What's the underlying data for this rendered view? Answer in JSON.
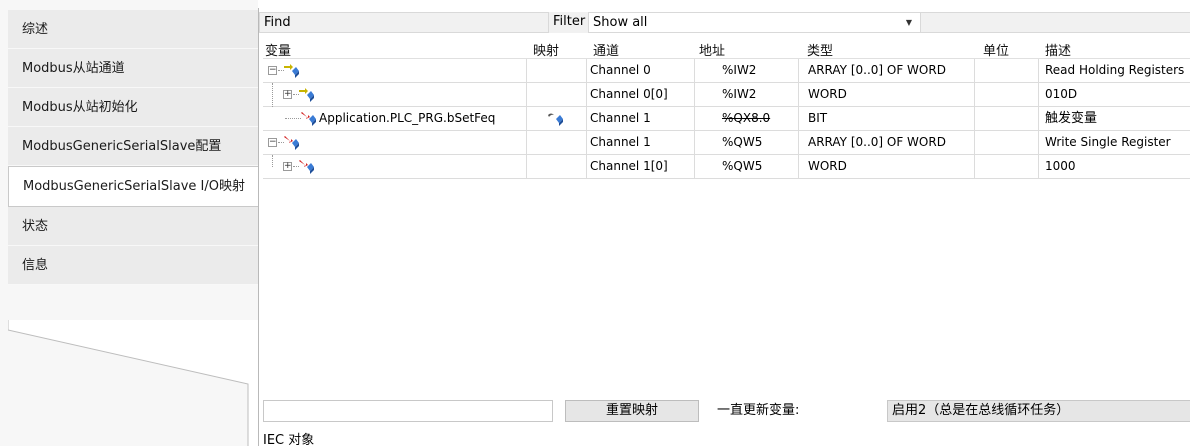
{
  "nav": {
    "items": [
      {
        "label": "综述"
      },
      {
        "label": "Modbus从站通道"
      },
      {
        "label": "Modbus从站初始化"
      },
      {
        "label": "ModbusGenericSerialSlave配置"
      },
      {
        "label": "ModbusGenericSerialSlave I/O映射",
        "active": true
      },
      {
        "label": "状态"
      },
      {
        "label": "信息"
      }
    ]
  },
  "toolbar": {
    "find_label": "Find",
    "filter_label": "Filter",
    "filter_value": "Show all"
  },
  "table": {
    "columns": [
      "变量",
      "映射",
      "通道",
      "地址",
      "类型",
      "单位",
      "描述"
    ],
    "rows": [
      {
        "variable": "",
        "mapping": "",
        "channel": "Channel 0",
        "address": "%IW2",
        "type": "ARRAY [0..0] OF WORD",
        "unit": "",
        "description": "Read Holding Registers",
        "expander": "−",
        "icon": "input-channel-icon"
      },
      {
        "variable": "",
        "mapping": "",
        "channel": "Channel 0[0]",
        "address": "%IW2",
        "type": "WORD",
        "unit": "",
        "description": "010D",
        "expander": "+",
        "icon": "input-channel-icon"
      },
      {
        "variable": "Application.PLC_PRG.bSetFeq",
        "mapping": "mapped",
        "channel": "Channel 1",
        "address": "%QX8.0",
        "type": "BIT",
        "unit": "",
        "description": "触发变量",
        "expander": "",
        "icon": "output-channel-icon"
      },
      {
        "variable": "",
        "mapping": "",
        "channel": "Channel 1",
        "address": "%QW5",
        "type": "ARRAY [0..0] OF WORD",
        "unit": "",
        "description": "Write Single Register",
        "expander": "−",
        "icon": "output-channel-icon"
      },
      {
        "variable": "",
        "mapping": "",
        "channel": "Channel 1[0]",
        "address": "%QW5",
        "type": "WORD",
        "unit": "",
        "description": "1000",
        "expander": "+",
        "icon": "output-channel-icon"
      }
    ]
  },
  "bottom": {
    "reset_label": "重置映射",
    "always_update_label": "一直更新变量:",
    "update_value": "启用2（总是在总线循环任务）",
    "iec_label": "IEC 对象"
  },
  "colors": {
    "input_arrow": "#c8b400",
    "output_arrow": "#d11f1f",
    "io_block": "#3a7bd5"
  }
}
